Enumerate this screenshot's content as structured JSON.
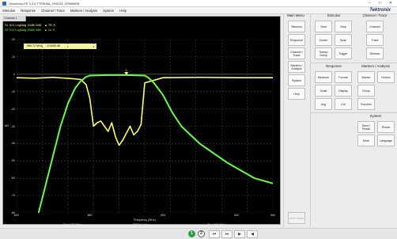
{
  "window": {
    "title": "Vectorbox-FE 3.4.5 TTR506A_VH5011_00989808",
    "controls": [
      "–",
      "□",
      "✕"
    ]
  },
  "menu": {
    "items": [
      "Stimulus",
      "Response",
      "Channel / Trace",
      "Markers / Analysis",
      "System",
      "Help"
    ],
    "brand": "Tektronix"
  },
  "channel_tab": "Channel 1",
  "traces": [
    {
      "label": "S1 S21 LogMag 10dB/ 0dB",
      "color": "#ffff66",
      "suffix": "▲ TR ✕"
    },
    {
      "label": "S2 S11 LogMag 10dB/ 0dB",
      "color": "#66ff44",
      "suffix": "▲ 2A ✕"
    }
  ],
  "marker": {
    "freq": "866.72 MHz",
    "value": "-0.5468 dB",
    "label": "1"
  },
  "stimulus": {
    "start": "Start 820 MHz",
    "ifbw": "IFBW 1 kHz",
    "stop": "Stop 960 MHz"
  },
  "chart_data": {
    "type": "line",
    "xlabel": "Frequency (MHz)",
    "ylabel": "dB",
    "xlim": [
      820,
      960
    ],
    "ylim": [
      -80,
      20
    ],
    "yticks": [
      "20",
      "10",
      "0",
      "-10",
      "-20",
      "-30",
      "-40",
      "-50",
      "-60",
      "-70",
      "-80"
    ],
    "xticks": [
      "820",
      "860",
      "900",
      "940",
      "960"
    ],
    "series": [
      {
        "name": "S21",
        "color": "#ffff66",
        "x": [
          820,
          830,
          840,
          850,
          855,
          858,
          860,
          862,
          864,
          866,
          868,
          870,
          872,
          874,
          876,
          878,
          880,
          882,
          884,
          886,
          888,
          890,
          900,
          920,
          940,
          960
        ],
        "y": [
          -2,
          -2.3,
          -1.8,
          -2.5,
          -3,
          -6,
          -14,
          -30,
          -28,
          -27,
          -30,
          -33,
          -28,
          -36,
          -41,
          -38,
          -34,
          -30,
          -35,
          -33,
          -29,
          -5,
          -2,
          -1.8,
          -2,
          -2
        ]
      },
      {
        "name": "S11",
        "color": "#66ff44",
        "x": [
          832,
          838,
          844,
          848,
          852,
          855,
          858,
          860,
          870,
          880,
          890,
          892,
          895,
          900,
          905,
          910,
          920,
          935,
          950,
          960
        ],
        "y": [
          -80,
          -55,
          -30,
          -17,
          -8,
          -4,
          -1.5,
          -0.8,
          -0.5,
          -0.5,
          -0.8,
          -2,
          -5,
          -12,
          -22,
          -30,
          -40,
          -51,
          -60,
          -63
        ]
      }
    ]
  },
  "panels": {
    "main_menu": {
      "title": "Main Menu",
      "items": [
        "Stimulus",
        "Response",
        "Channel / Trace",
        "Markers / Analysis",
        "System",
        "Help"
      ],
      "footer": "Main Menu"
    },
    "stimulus": {
      "title": "Stimulus",
      "items": [
        "Start",
        "Stop",
        "Center",
        "Span",
        "Sweep Setup",
        "Trigger"
      ]
    },
    "channel_trace": {
      "title": "Channel / Trace",
      "items": [
        "Channel",
        "Trace",
        "Window"
      ]
    },
    "response": {
      "title": "Response",
      "items": [
        "Measure",
        "Format",
        "Scale",
        "Display",
        "Avg",
        "Cal"
      ]
    },
    "markers": {
      "title": "Markers / Analysis",
      "items": [
        "Marker",
        "Search",
        "Setup",
        "Function"
      ]
    },
    "system": {
      "title": "System",
      "items": [
        "Save / Recall",
        "Preset",
        "More",
        "Language"
      ]
    }
  },
  "statusbar": {
    "ind1": "1",
    "ind2": "2",
    "extra": [
      "⏮",
      "⏭",
      "▶",
      "◀"
    ]
  }
}
